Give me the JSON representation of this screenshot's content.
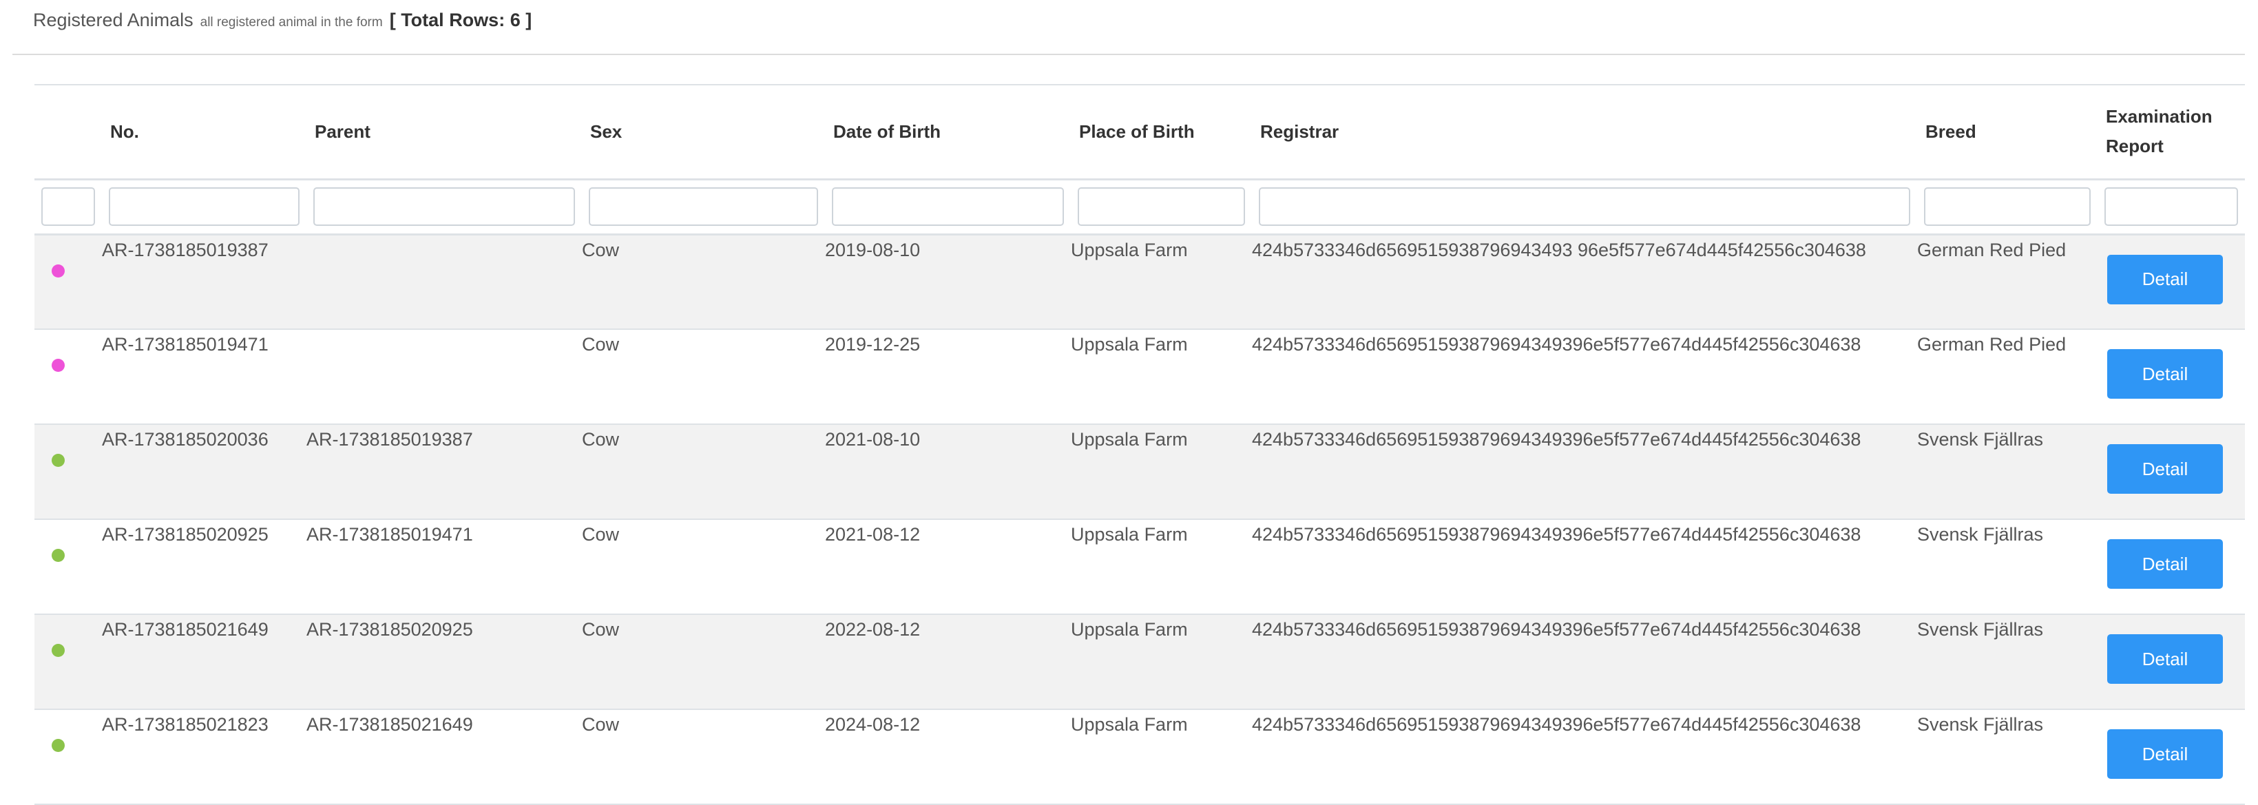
{
  "header": {
    "title": "Registered Animals",
    "subtitle": "all registered animal in the form",
    "total_rows": "[ Total Rows: 6 ]"
  },
  "columns": {
    "no": "No.",
    "parent": "Parent",
    "sex": "Sex",
    "dob": "Date of Birth",
    "place": "Place of Birth",
    "registrar": "Registrar",
    "breed": "Breed",
    "report": "Examination Report"
  },
  "filters": {
    "select": "",
    "no": "",
    "parent": "",
    "sex": "",
    "dob": "",
    "place": "",
    "registrar": "",
    "breed": "",
    "report": ""
  },
  "status_colors": {
    "pink": "#ee52d8",
    "green": "#8bc34a"
  },
  "rows": [
    {
      "status": "pink",
      "no": "AR-1738185019387",
      "parent": "",
      "sex": "Cow",
      "dob": "2019-08-10",
      "place": "Uppsala Farm",
      "registrar": "424b5733346d6569515938796943493 96e5f577e674d445f42556c304638",
      "breed": "German Red Pied",
      "action": "Detail"
    },
    {
      "status": "pink",
      "no": "AR-1738185019471",
      "parent": "",
      "sex": "Cow",
      "dob": "2019-12-25",
      "place": "Uppsala Farm",
      "registrar": "424b5733346d656951593879694349396e5f577e674d445f42556c304638",
      "breed": "German Red Pied",
      "action": "Detail"
    },
    {
      "status": "green",
      "no": "AR-1738185020036",
      "parent": "AR-1738185019387",
      "sex": "Cow",
      "dob": "2021-08-10",
      "place": "Uppsala Farm",
      "registrar": "424b5733346d656951593879694349396e5f577e674d445f42556c304638",
      "breed": "Svensk Fjällras",
      "action": "Detail"
    },
    {
      "status": "green",
      "no": "AR-1738185020925",
      "parent": "AR-1738185019471",
      "sex": "Cow",
      "dob": "2021-08-12",
      "place": "Uppsala Farm",
      "registrar": "424b5733346d656951593879694349396e5f577e674d445f42556c304638",
      "breed": "Svensk Fjällras",
      "action": "Detail"
    },
    {
      "status": "green",
      "no": "AR-1738185021649",
      "parent": "AR-1738185020925",
      "sex": "Cow",
      "dob": "2022-08-12",
      "place": "Uppsala Farm",
      "registrar": "424b5733346d656951593879694349396e5f577e674d445f42556c304638",
      "breed": "Svensk Fjällras",
      "action": "Detail"
    },
    {
      "status": "green",
      "no": "AR-1738185021823",
      "parent": "AR-1738185021649",
      "sex": "Cow",
      "dob": "2024-08-12",
      "place": "Uppsala Farm",
      "registrar": "424b5733346d656951593879694349396e5f577e674d445f42556c304638",
      "breed": "Svensk Fjällras",
      "action": "Detail"
    }
  ]
}
